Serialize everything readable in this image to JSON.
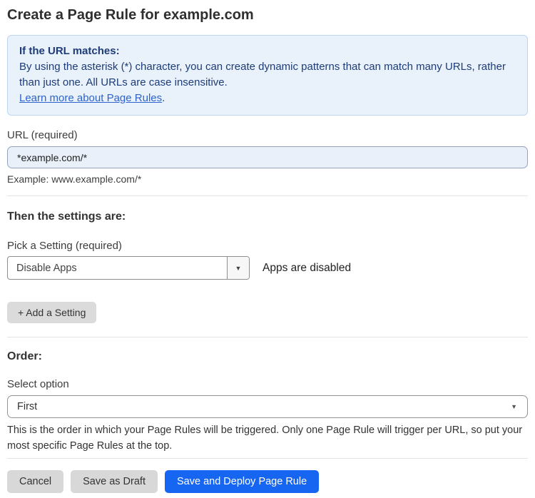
{
  "page": {
    "title": "Create a Page Rule for example.com"
  },
  "info_box": {
    "heading": "If the URL matches:",
    "body": "By using the asterisk (*) character, you can create dynamic patterns that can match many URLs, rather than just one. All URLs are case insensitive.",
    "link_label": "Learn more about Page Rules",
    "link_suffix": "."
  },
  "url_field": {
    "label": "URL (required)",
    "value": "*example.com/*",
    "hint": "Example: www.example.com/*"
  },
  "settings_section": {
    "heading": "Then the settings are:",
    "setting_label": "Pick a Setting (required)",
    "setting_value": "Disable Apps",
    "setting_status": "Apps are disabled",
    "add_setting_label": "+ Add a Setting"
  },
  "order_section": {
    "heading": "Order:",
    "select_label": "Select option",
    "select_value": "First",
    "hint": "This is the order in which your Page Rules will be triggered. Only one Page Rule will trigger per URL, so put your most specific Page Rules at the top."
  },
  "actions": {
    "cancel_label": "Cancel",
    "save_draft_label": "Save as Draft",
    "save_deploy_label": "Save and Deploy Page Rule"
  },
  "icons": {
    "dropdown_caret": "▼"
  },
  "colors": {
    "info_bg": "#e9f1fb",
    "info_border": "#bcd7f1",
    "info_text": "#1d3c78",
    "link": "#2c63cf",
    "input_bg": "#e9f0fa",
    "primary_button": "#1766f2",
    "gray_button": "#d8d8d8"
  }
}
